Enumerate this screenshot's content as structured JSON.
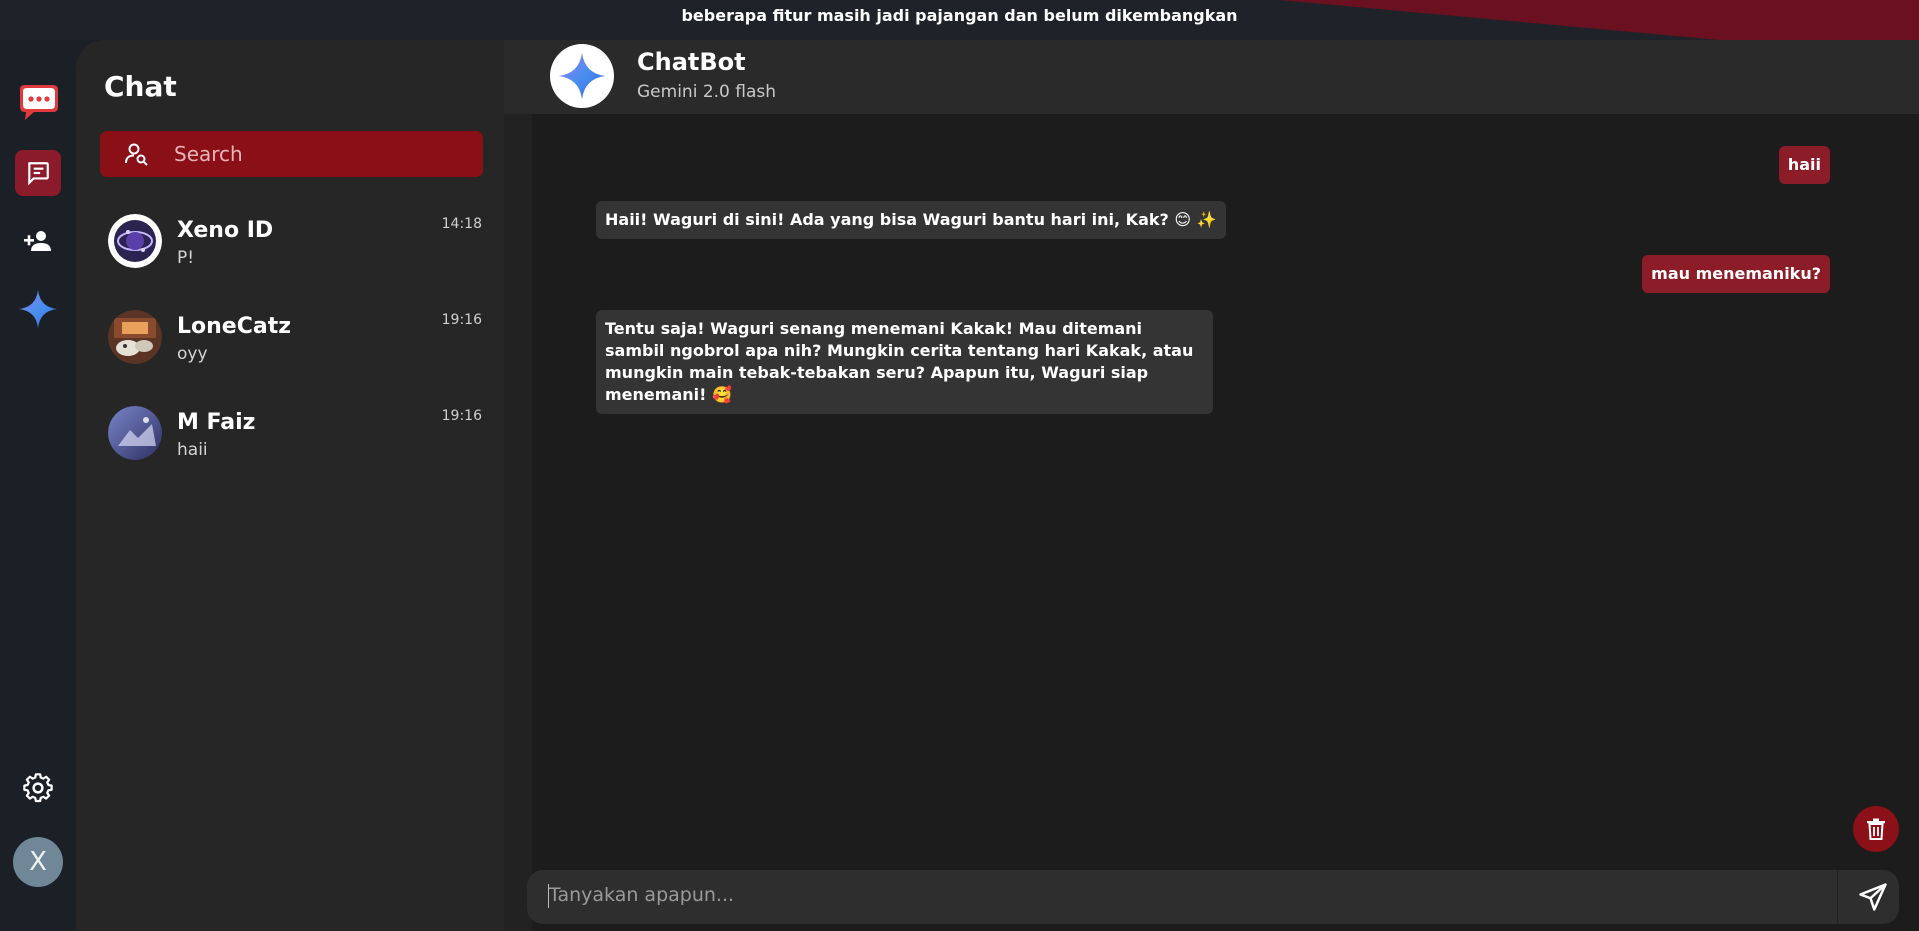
{
  "banner": {
    "notice": "beberapa fitur masih jadi pajangan dan belum dikembangkan"
  },
  "rail": {
    "items": [
      {
        "icon": "chat-bubble-logo-icon",
        "active": false
      },
      {
        "icon": "messages-icon",
        "active": true
      },
      {
        "icon": "add-user-icon",
        "active": false
      },
      {
        "icon": "gemini-sparkle-icon",
        "active": false
      }
    ],
    "settings_icon": "gear-icon",
    "avatar_letter": "X"
  },
  "chat_list": {
    "title": "Chat",
    "search_placeholder": "Search",
    "contacts": [
      {
        "name": "Xeno ID",
        "last_message": "P!",
        "time": "14:18"
      },
      {
        "name": "LoneCatz",
        "last_message": "oyy",
        "time": "19:16"
      },
      {
        "name": "M Faiz",
        "last_message": "haii",
        "time": "19:16"
      }
    ]
  },
  "conversation": {
    "bot_name": "ChatBot",
    "bot_model": "Gemini 2.0 flash",
    "messages": [
      {
        "role": "user",
        "text": "haii"
      },
      {
        "role": "bot",
        "text": "Haii! Waguri di sini! Ada yang bisa Waguri bantu hari ini, Kak? 😊 ✨"
      },
      {
        "role": "user",
        "text": "mau menemaniku?"
      },
      {
        "role": "bot",
        "text": "Tentu saja! Waguri senang menemani Kakak! Mau ditemani sambil ngobrol apa nih? Mungkin cerita tentang hari Kakak, atau mungkin main tebak-tebakan seru? Apapun itu, Waguri siap menemani! 🥰"
      }
    ],
    "input_placeholder": "Tanyakan apapun..."
  },
  "colors": {
    "accent": "#8b0f16",
    "user_bubble": "#8d1c29",
    "bot_bubble": "#343434"
  }
}
